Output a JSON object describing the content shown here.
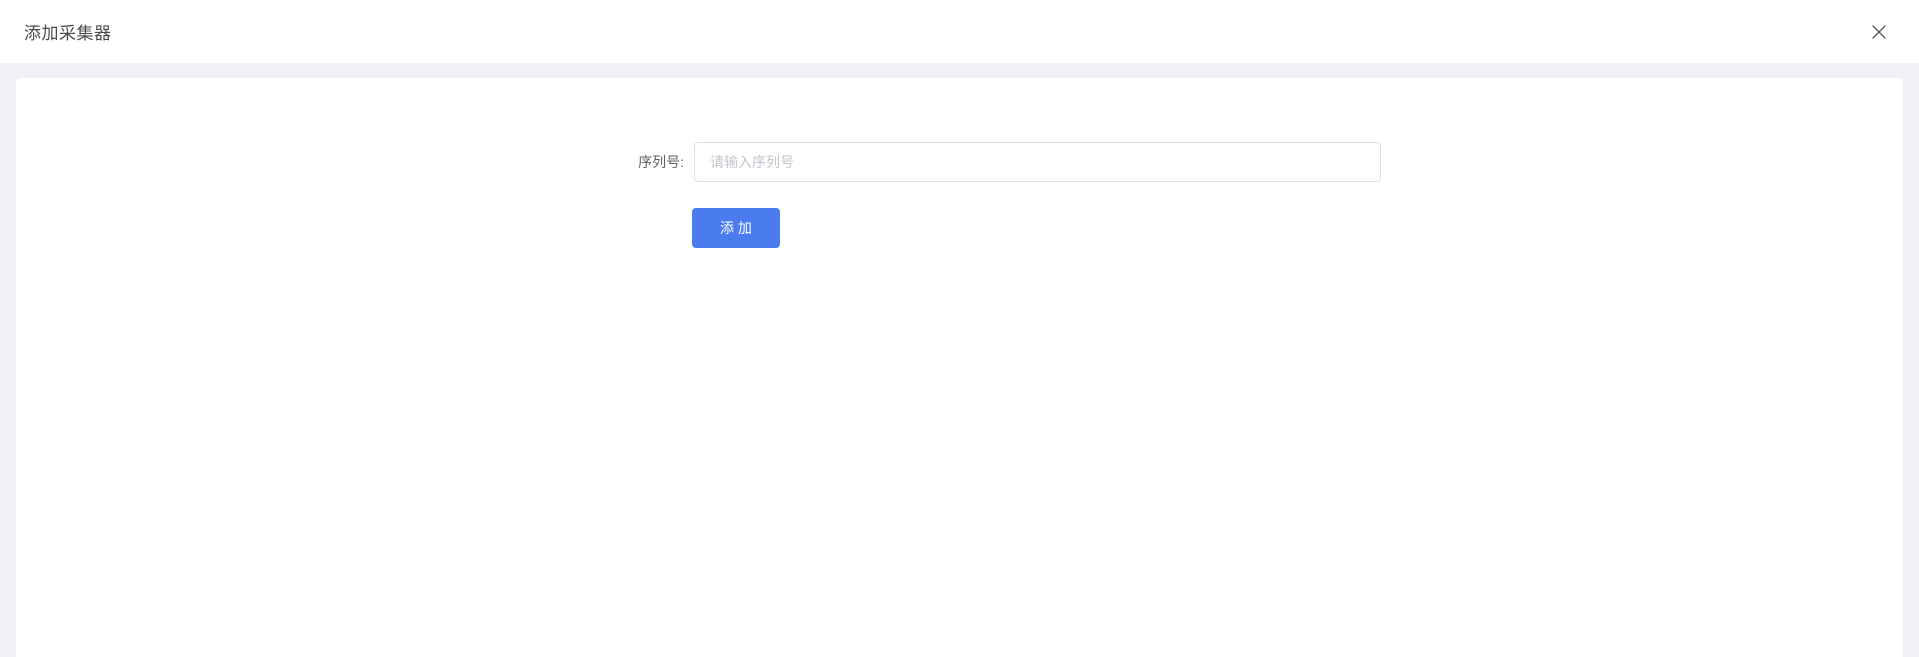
{
  "header": {
    "title": "添加采集器"
  },
  "form": {
    "serial_label": "序列号:",
    "serial_placeholder": "请输入序列号",
    "serial_value": "",
    "submit_label": "添 加"
  },
  "icons": {
    "close": "x-close"
  },
  "colors": {
    "primary_button": "#4a7cf0",
    "page_background": "#f0f1f5",
    "panel_background": "#ffffff",
    "input_border": "#dcdfe6",
    "placeholder_text": "#c0c4cc",
    "title_text": "#4a4a4a"
  }
}
